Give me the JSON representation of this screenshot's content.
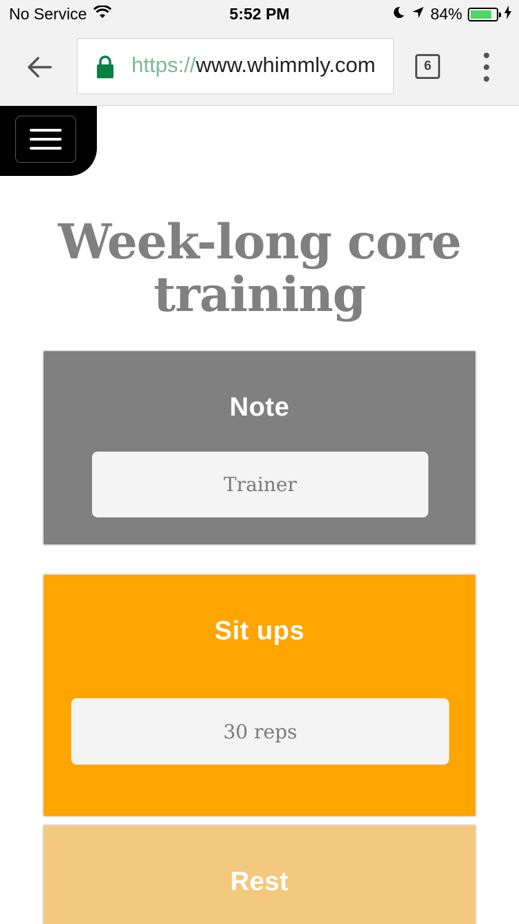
{
  "status_bar": {
    "carrier": "No Service",
    "time": "5:52 PM",
    "battery_percent": "84%",
    "battery_level": 0.84,
    "battery_color": "#4cd964"
  },
  "browser": {
    "url_scheme": "https://",
    "url_host": "www.whimmly.com",
    "tab_count": "6",
    "lock_color": "#0b8043",
    "icons": [
      "back-arrow-icon",
      "lock-icon",
      "tabs-icon",
      "overflow-menu-icon"
    ]
  },
  "page": {
    "menu_icon": "hamburger-icon",
    "title": "Week-long core training",
    "cards": [
      {
        "title": "Note",
        "field": "Trainer",
        "color": "#808080"
      },
      {
        "title": "Sit ups",
        "field": "30 reps",
        "color": "#ffa500"
      },
      {
        "title": "Rest",
        "color": "#f2c97e"
      }
    ]
  }
}
